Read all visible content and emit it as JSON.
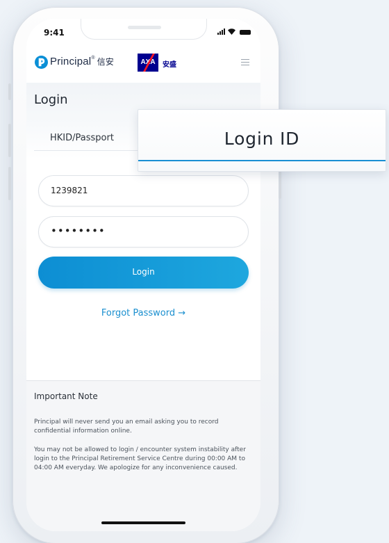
{
  "status": {
    "time": "9:41"
  },
  "header": {
    "brand": "Principal",
    "brand_cn": "信安",
    "partner_logo": "AXA",
    "partner_cn": "安盛",
    "menu_icon": "hamburger-menu-icon"
  },
  "login": {
    "title": "Login",
    "tab_hkid": "HKID/Passport",
    "login_id_value": "1239821",
    "password_value": "••••••••",
    "login_button": "Login",
    "forgot_password": "Forgot Password →"
  },
  "note": {
    "title": "Important Note",
    "p1": "Principal will never send you an email asking you to record confidential information online.",
    "p2": "You may not be allowed to login / encounter system instability after login to the Principal Retirement Service Centre during 00:00 AM to 04:00 AM everyday. We apologize for any inconvenience caused."
  },
  "callout": {
    "label": "Login ID"
  },
  "colors": {
    "accent": "#1a8fd3",
    "button_start": "#0d8ed3",
    "button_end": "#1ea7de",
    "axa_blue": "#00008f",
    "axa_red": "#ff1721",
    "background": "#eef3f8"
  }
}
